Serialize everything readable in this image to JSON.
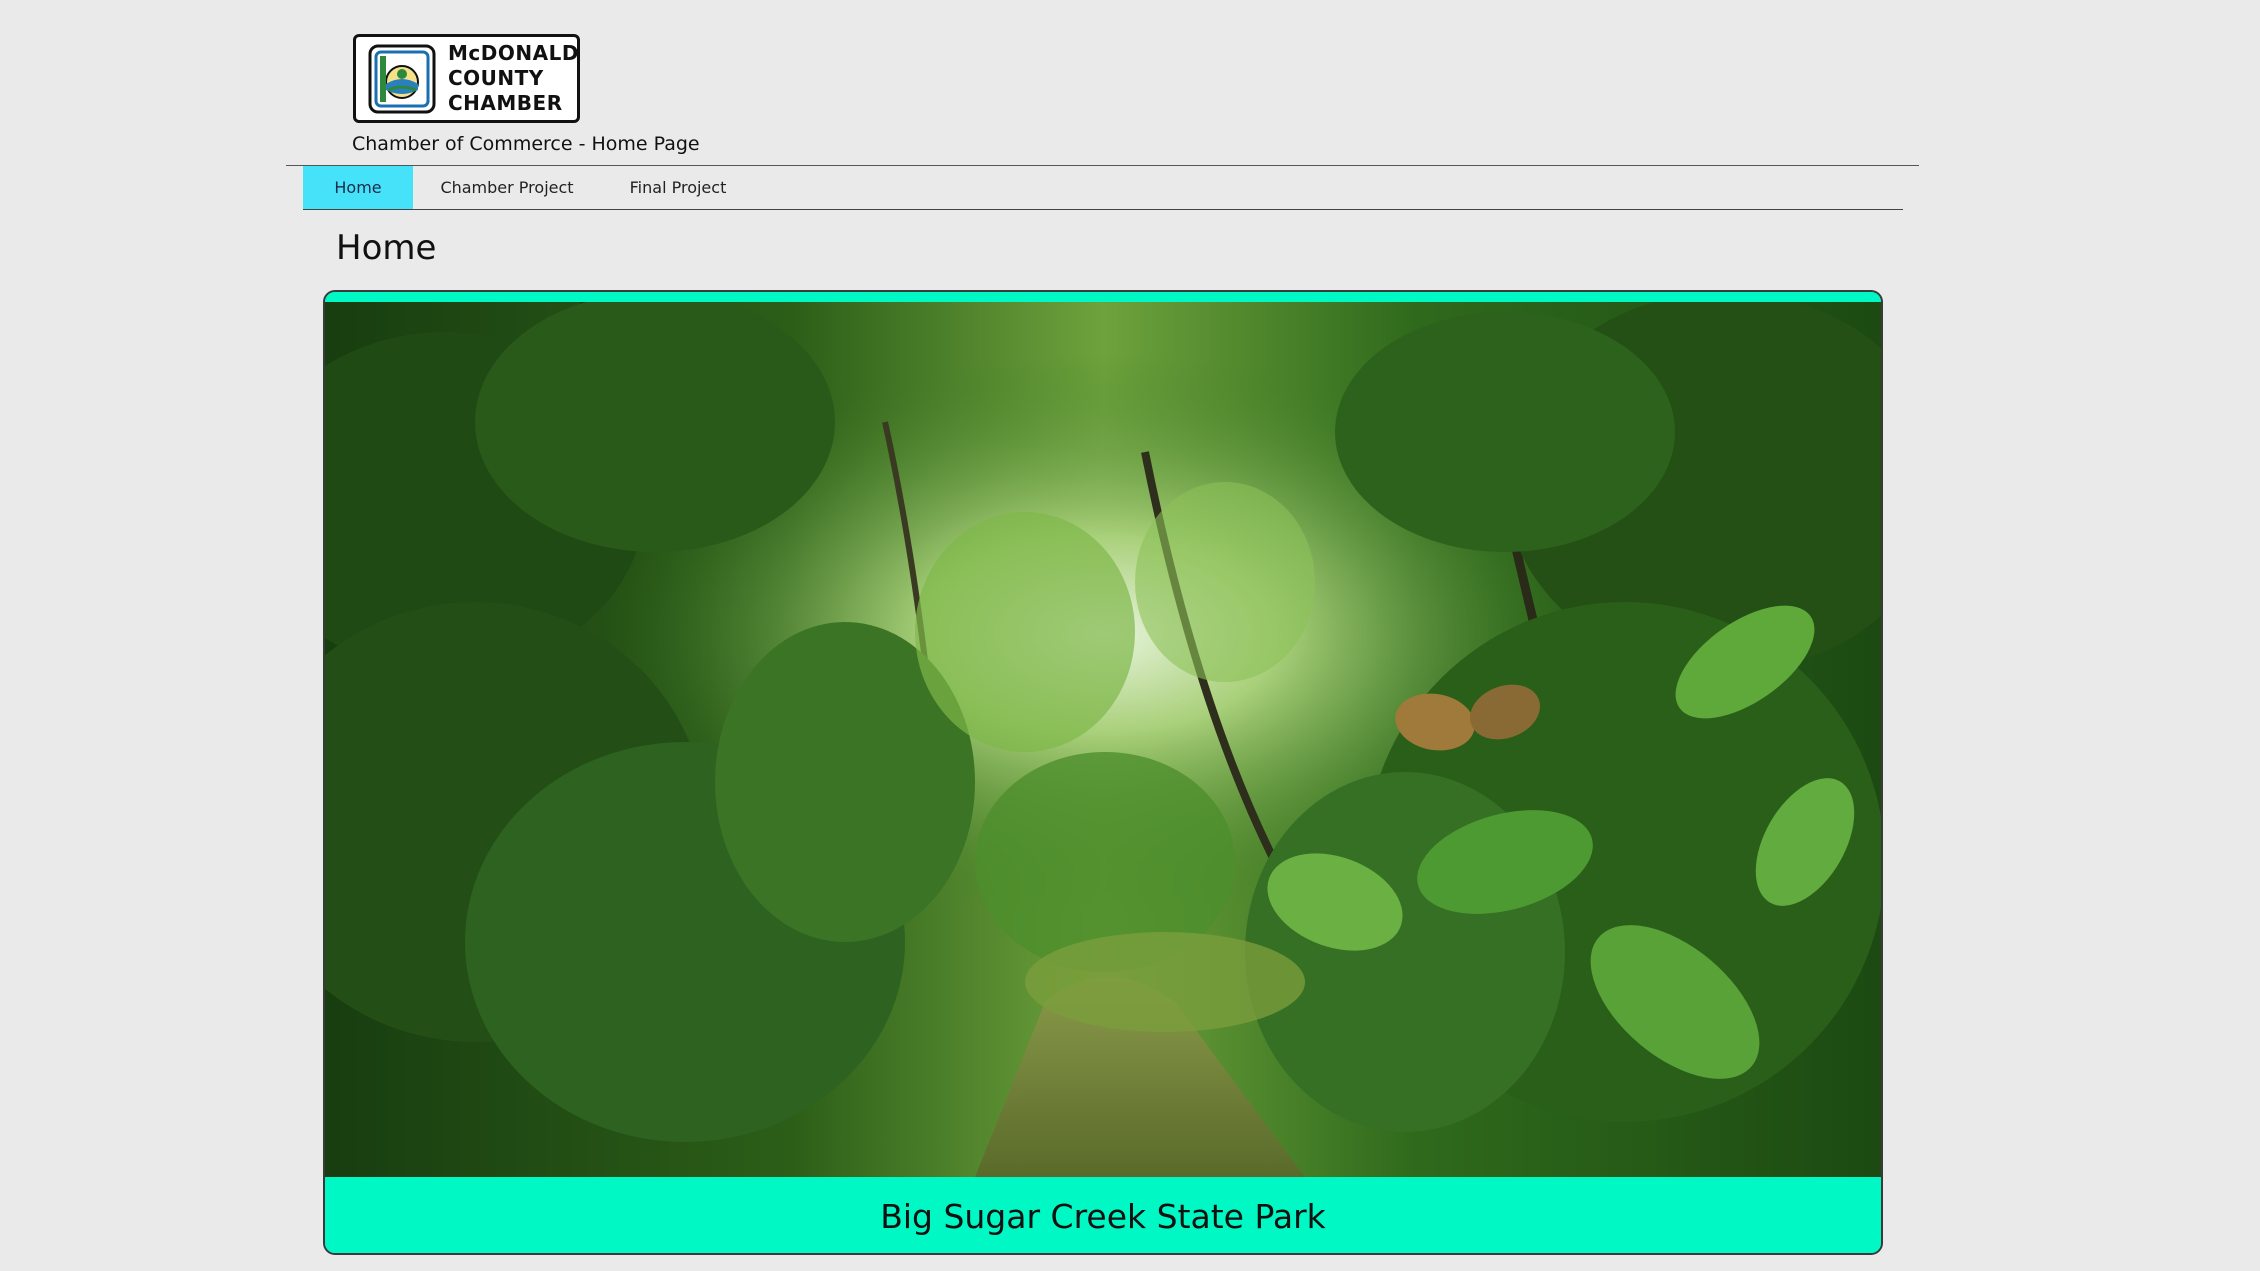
{
  "logo": {
    "line1": "McDONALD",
    "line2": "COUNTY",
    "line3": "CHAMBER",
    "icon": "chamber-logo-icon"
  },
  "header": {
    "subtitle": "Chamber of Commerce - Home Page"
  },
  "nav": {
    "items": [
      {
        "label": "Home",
        "active": true
      },
      {
        "label": "Chamber Project",
        "active": false
      },
      {
        "label": "Final Project",
        "active": false
      }
    ],
    "active_color": "#46e2fa"
  },
  "main": {
    "title": "Home",
    "slide": {
      "caption": "Big Sugar Creek State Park",
      "caption_bg": "#00f8c4"
    }
  },
  "colors": {
    "background": "#eaeaea",
    "accent": "#00f8c4"
  }
}
